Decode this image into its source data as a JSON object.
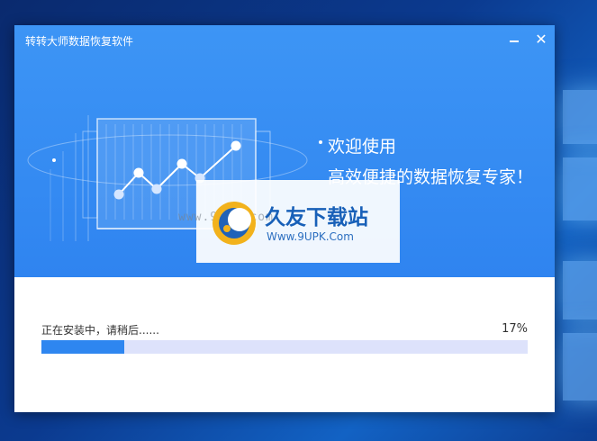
{
  "window": {
    "title": "转转大师数据恢复软件",
    "minimize_icon": "minimize-icon",
    "close_icon": "close-icon"
  },
  "hero": {
    "welcome": "欢迎使用",
    "slogan": "高效便捷的数据恢复专家！",
    "illustration": "line-chart-dashboard"
  },
  "watermark": {
    "name": "久友下载站",
    "url": "Www.9UPK.Com",
    "url_faint": "www.9UPK.com"
  },
  "install": {
    "status": "正在安装中，请稍后......",
    "percent_label": "17%",
    "progress": 0.17
  },
  "colors": {
    "accent": "#2e86f0",
    "hero_bg": "#3d95f5",
    "track": "#dde2fb"
  }
}
